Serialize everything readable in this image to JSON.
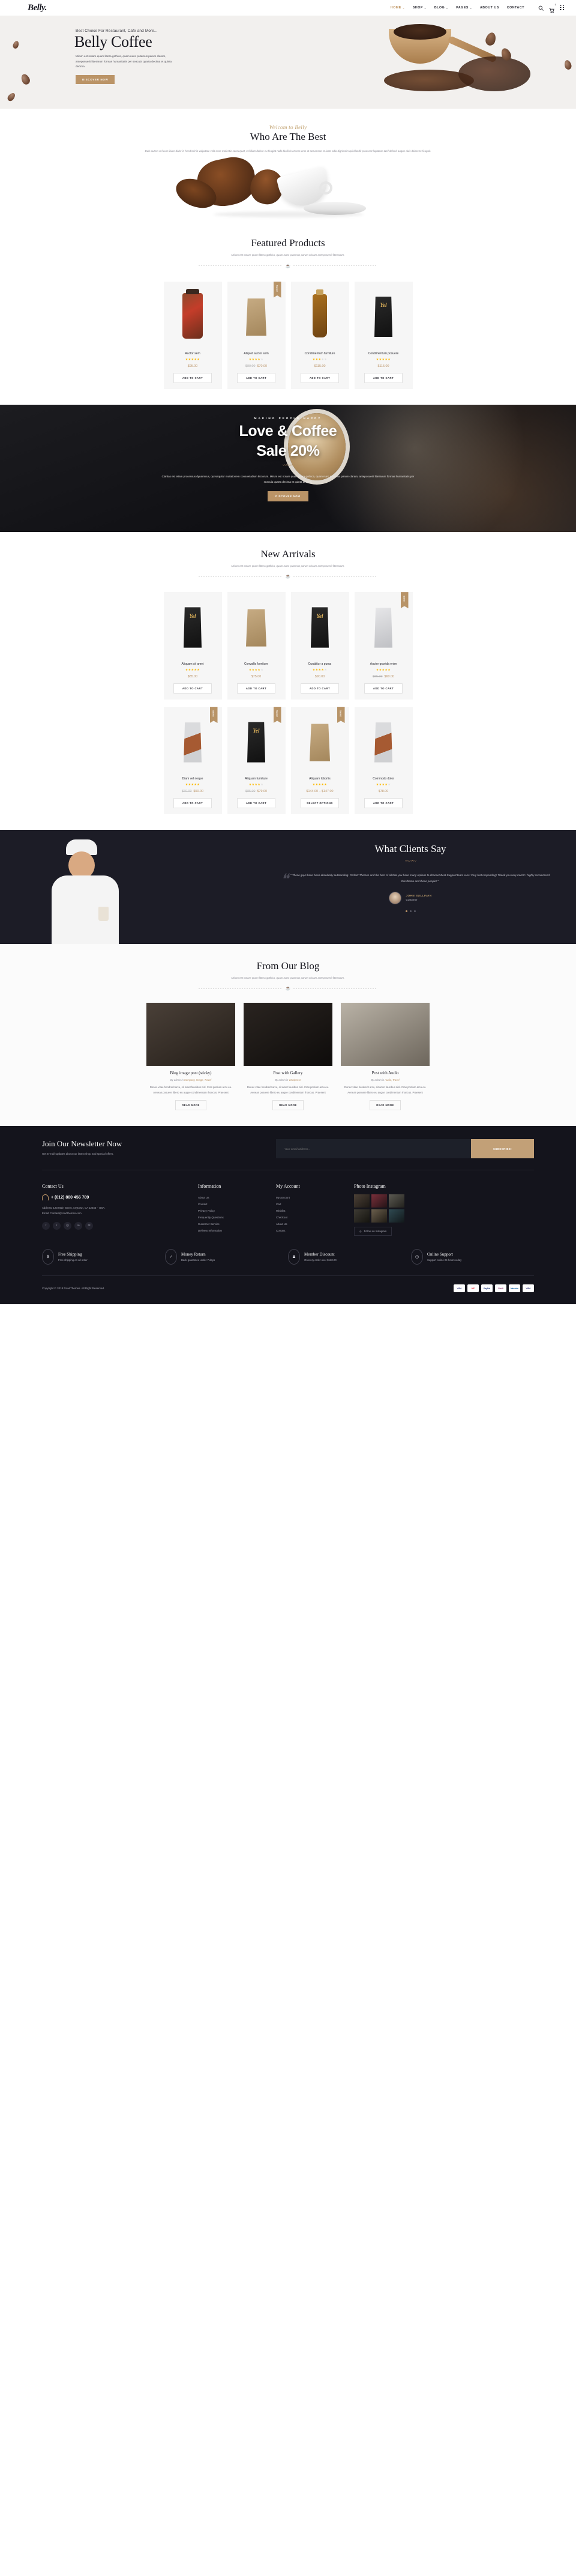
{
  "header": {
    "logo": "Belly.",
    "nav": [
      {
        "label": "HOME",
        "caret": "⌄",
        "active": true
      },
      {
        "label": "SHOP",
        "caret": "⌄",
        "active": false
      },
      {
        "label": "BLOG",
        "caret": "⌄",
        "active": false
      },
      {
        "label": "PAGES",
        "caret": "⌄",
        "active": false
      },
      {
        "label": "ABOUT US",
        "caret": "",
        "active": false
      },
      {
        "label": "CONTACT",
        "caret": "",
        "active": false
      }
    ],
    "search_icon": "🔍",
    "cart_icon": "🛒",
    "cart_count": "0"
  },
  "hero": {
    "subtitle": "Best Choice For Restaurant, Cafe and More...",
    "title": "Belly Coffee",
    "text": "Mirum est notare quam littera gothica, quam nunc putamus parum claram, anteposuerit litterarum formas humanitatis per seacula quarta decima et quinta decima.",
    "button": "DISCOVER NOW"
  },
  "about": {
    "script": "Welcom to Belly",
    "heading": "Who Are The Best",
    "paragraph": "Duis autem vel eum iriure dolor in hendrerit in vulputate velit esse molestie consequat, vel illum dolore eu feugiat nulla facilisis at vero eros et accumsan et iusto odio dignissim qui blandit praesent luptatum zzril delenit augue duis dolore te feugait."
  },
  "featured": {
    "heading": "Featured Products",
    "subtitle": "Mirum est notare quam littera gothica, quam nunc putamus parum claram anteposuerit litterarum.",
    "products": [
      {
        "name": "Auctor sem",
        "stars": 5,
        "price": "$95.00",
        "old": "",
        "button": "ADD TO CART",
        "sale": false,
        "art": "jar"
      },
      {
        "name": "Aliquet auctor sem",
        "stars": 4,
        "price": "$70.00",
        "old": "$80.00",
        "button": "ADD TO CART",
        "sale": true,
        "sale_label": "Sale!",
        "art": "bagk"
      },
      {
        "name": "Condimentum furniture",
        "stars": 3,
        "price": "$115.00",
        "old": "",
        "button": "ADD TO CART",
        "sale": false,
        "art": "bottle"
      },
      {
        "name": "Condimentum posuere",
        "stars": 5,
        "price": "$115.00",
        "old": "",
        "button": "ADD TO CART",
        "sale": false,
        "art": "darkbag"
      }
    ]
  },
  "promo": {
    "kicker": "MAKING PEOPLE HAPPY",
    "line1": "Love & Coffee",
    "line2": "Sale 20%",
    "paragraph": "Claritas est etiam processus dynamicus, qui sequitur mutationem consuetudium lectorum. Mirum est notare quam littera gothica, quam nunc putamus parum claram, anteposuerit litterarum formas humanitatis per seacula quarta decima et quinta decima.",
    "button": "DISCOVER NOW"
  },
  "arrivals": {
    "heading": "New Arrivals",
    "subtitle": "Mirum est notare quam littera gothica, quam nunc putamus parum claram anteposuerit litterarum.",
    "row1": [
      {
        "name": "Aliquam sit amet",
        "stars": 5,
        "price": "$85.00",
        "old": "",
        "button": "ADD TO CART",
        "sale": false,
        "art": "darkbag"
      },
      {
        "name": "Convallis furniture",
        "stars": 4,
        "price": "$75.00",
        "old": "",
        "button": "ADD TO CART",
        "sale": false,
        "art": "bagk"
      },
      {
        "name": "Curabitur a purus",
        "stars": 4,
        "price": "$90.00",
        "old": "",
        "button": "ADD TO CART",
        "sale": false,
        "art": "darkbag"
      },
      {
        "name": "Auctor gravida enim",
        "stars": 5,
        "price": "$60.00",
        "old": "$85.00",
        "button": "ADD TO CART",
        "sale": true,
        "sale_label": "Sale!",
        "art": "graybag"
      }
    ],
    "row2": [
      {
        "name": "Diam vel neque",
        "stars": 5,
        "price": "$50.00",
        "old": "$60.00",
        "button": "ADD TO CART",
        "sale": true,
        "sale_label": "Sale!",
        "art": "colbag"
      },
      {
        "name": "Aliquam furniture",
        "stars": 4,
        "price": "$79.00",
        "old": "$85.00",
        "button": "ADD TO CART",
        "sale": true,
        "sale_label": "Sale!",
        "art": "darkbag"
      },
      {
        "name": "Aliquam lobortis",
        "stars": 5,
        "price": "$144.00 – $147.00",
        "old": "",
        "button": "SELECT OPTIONS",
        "sale": true,
        "sale_label": "Sale!",
        "art": "bagk"
      },
      {
        "name": "Commodo dolor",
        "stars": 4,
        "price": "$78.00",
        "old": "",
        "button": "ADD TO CART",
        "sale": false,
        "art": "colbag"
      }
    ]
  },
  "testimonial": {
    "heading": "What Clients Say",
    "quote": "\" These guys have been absolutely outstanding. Perfect Themes and the best of all that you have many options to choose! Best Support team ever! Very fast responding! Thank you very much! I highly recommend this theme and these people! \"",
    "author": "JOHN SULLIVAN",
    "role": "Customer"
  },
  "blog": {
    "heading": "From Our Blog",
    "subtitle": "Mirum est notare quam littera gothica, quam nunc putamus parum claram anteposuerit litterarum.",
    "posts": [
      {
        "title": "Blog image post (sticky)",
        "meta_by": "By admin in ",
        "meta_cats": "Company, Image, Travel",
        "excerpt": "Donec vitae hendrerit arcu, sit amet faucibus nisl. Cras pretium arcu eu. Aenean posuere libero eu augue condimentum rhoncus. Praesent",
        "button": "READ MORE"
      },
      {
        "title": "Post with Gallery",
        "meta_by": "By admin in ",
        "meta_cats": "Wordpress",
        "excerpt": "Donec vitae hendrerit arcu, sit amet faucibus nisl. Cras pretium arcu eu. Aenean posuere libero eu augue condimentum rhoncus. Praesent",
        "button": "READ MORE"
      },
      {
        "title": "Post with Audio",
        "meta_by": "By admin in ",
        "meta_cats": "Audio, Travel",
        "excerpt": "Donec vitae hendrerit arcu, sit amet faucibus nisl. Cras pretium arcu eu. Aenean posuere libero eu augue condimentum rhoncus. Praesent",
        "button": "READ MORE"
      }
    ]
  },
  "newsletter": {
    "heading": "Join Our Newsletter Now",
    "subtitle": "Get E-mail updates about our latest shop and special offers.",
    "placeholder": "Your email address...",
    "button": "SUBSCRIBE!"
  },
  "footer": {
    "contact": {
      "title": "Contact Us",
      "phone": "+ (012) 800 456 789",
      "address": "Address: 123 Main Street, Anytown, CA 12345 – USA.",
      "email": "Email: Contact@roadthemes.com",
      "socials": [
        "f",
        "t",
        "◎",
        "in",
        "≋"
      ]
    },
    "information": {
      "title": "Information",
      "links": [
        "About Us",
        "Contact",
        "Privacy Policy",
        "Frequently Questions",
        "Customer Service",
        "Delivery Information"
      ]
    },
    "account": {
      "title": "My Account",
      "links": [
        "My account",
        "Cart",
        "Wishlist",
        "Checkout",
        "About Us",
        "Contact"
      ]
    },
    "instagram": {
      "title": "Photo Instagram",
      "button": "Follow on Instagram"
    },
    "services": [
      {
        "icon": "$",
        "title": "Free Shipping",
        "text": "Free shipping on all order"
      },
      {
        "icon": "✓",
        "title": "Money Return",
        "text": "Back guarantee under 7 days"
      },
      {
        "icon": "♟",
        "title": "Member Discount",
        "text": "Onevery order over $120.00"
      },
      {
        "icon": "◷",
        "title": "Online Support",
        "text": "Support online 24 hours a day"
      }
    ],
    "copyright": "Copyright © 2018 RoadThemes. All Right Reserved.",
    "cards": [
      "VISA",
      "MC",
      "PayPal",
      "Skrill",
      "Maestro",
      "VISA"
    ]
  }
}
